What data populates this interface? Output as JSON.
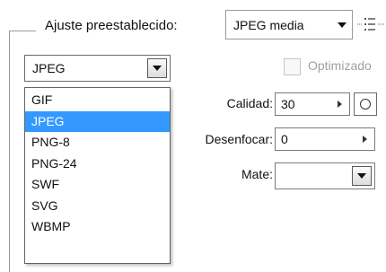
{
  "preset": {
    "label": "Ajuste preestablecido:",
    "value": "JPEG media",
    "menu_icon": "panel-menu-icon"
  },
  "format": {
    "value": "JPEG",
    "options": [
      "GIF",
      "JPEG",
      "PNG-8",
      "PNG-24",
      "SWF",
      "SVG",
      "WBMP"
    ],
    "selected_index": 1
  },
  "optimized": {
    "label": "Optimizado",
    "checked": false
  },
  "quality": {
    "label": "Calidad:",
    "value": "30"
  },
  "blur": {
    "label": "Desenfocar:",
    "value": "0"
  },
  "matte": {
    "label": "Mate:",
    "value": ""
  },
  "colors": {
    "selection": "#3399ff",
    "disabled_text": "#a0a0a0"
  }
}
